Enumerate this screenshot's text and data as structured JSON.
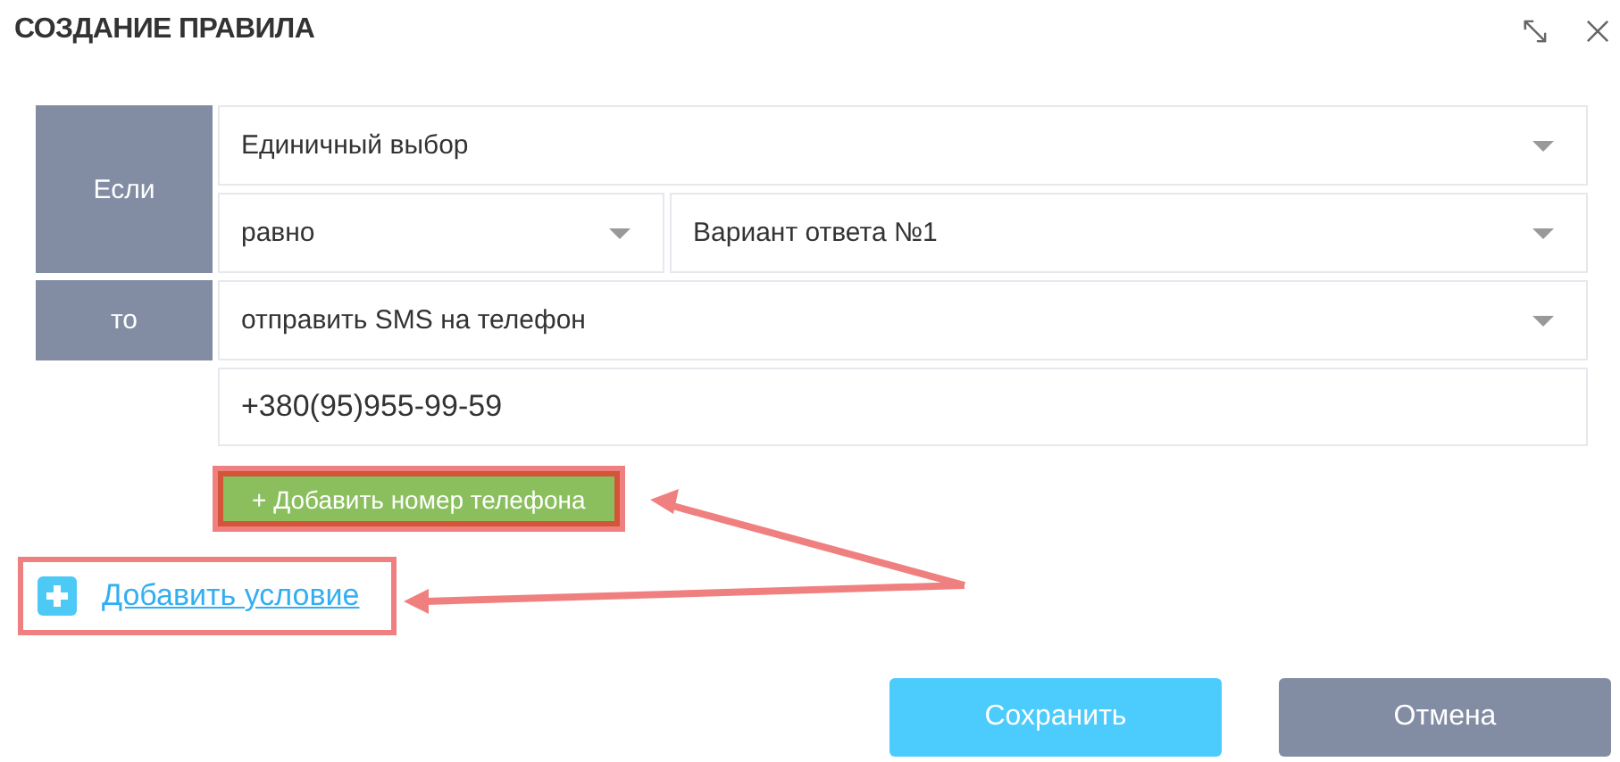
{
  "dialog": {
    "title": "СОЗДАНИЕ ПРАВИЛА"
  },
  "condition": {
    "label": "Если",
    "field": {
      "value": "Единичный выбор"
    },
    "operator": {
      "value": "равно"
    },
    "answer": {
      "value": "Вариант ответа №1"
    }
  },
  "action": {
    "label": "то",
    "field": {
      "value": "отправить SMS на телефон"
    },
    "phones": [
      {
        "value": "+380(95)955-99-59"
      }
    ],
    "add_phone_button": {
      "label": "+ Добавить номер телефона",
      "highlighted": true
    }
  },
  "add_condition_link": {
    "label": "Добавить условие",
    "highlighted": true
  },
  "buttons": [
    {
      "label": "Сохранить",
      "kind": "primary"
    },
    {
      "label": "Отмена",
      "kind": "secondary"
    }
  ]
}
